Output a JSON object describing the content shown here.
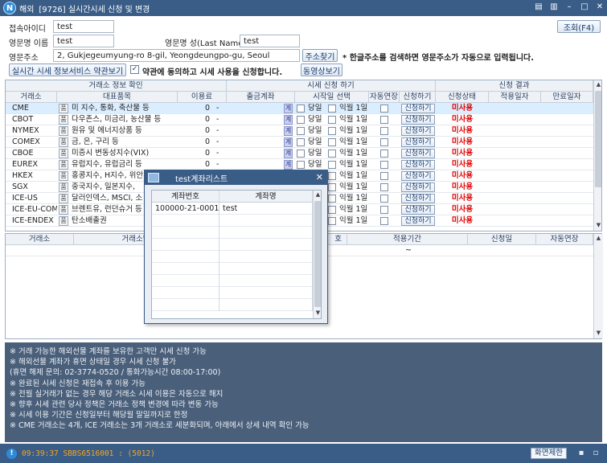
{
  "window": {
    "brand": "해외",
    "logo_char": "N",
    "title": "[9726] 실시간시세 신청 및 변경",
    "controls": [
      "▤",
      "▥",
      "–",
      "□",
      "✕"
    ]
  },
  "form": {
    "login_id_label": "접속아이디",
    "login_id_value": "test",
    "eng_first_label": "영문명 이름",
    "eng_first_value": "test",
    "eng_last_label": "영문명 성(Last Name)",
    "eng_last_value": "test",
    "eng_addr_label": "영문주소",
    "eng_addr_value": "2, Gukjegeumyung-ro 8-gil, Yeongdeungpo-gu, Seoul",
    "addr_search_btn": "주소찾기",
    "addr_note": "* 한글주소를 검색하면 영문주소가 자동으로 입력됩니다.",
    "query_btn": "조회(F4)",
    "terms_btn": "실시간 시세 정보서비스 약관보기",
    "agree_check": "✓",
    "agree_label": "약관에 동의하고 시세 사용을 신청합니다.",
    "video_btn": "동영상보기"
  },
  "grid": {
    "groups": [
      "거래소 정보 확인",
      "시세 신청 하기",
      "신청 결과"
    ],
    "columns": [
      "거래소",
      "대표품목",
      "이용료",
      "출금계좌",
      "시작일 선택",
      "자동연장",
      "신청하기",
      "신청상태",
      "적용일자",
      "만료일자"
    ],
    "pm_label": "품",
    "gye_label": "계",
    "opt_today": "당일",
    "opt_next_month": "익월 1일",
    "apply_label": "신청하기",
    "rows": [
      {
        "exchange": "CME",
        "item": "미 지수, 통화, 축산물 등",
        "fee": "0",
        "dash": "-",
        "status": "미사용"
      },
      {
        "exchange": "CBOT",
        "item": "다우존스, 미금리, 농산물 등",
        "fee": "0",
        "dash": "-",
        "status": "미사용"
      },
      {
        "exchange": "NYMEX",
        "item": "원유 및 에너지상품 등",
        "fee": "0",
        "dash": "-",
        "status": "미사용"
      },
      {
        "exchange": "COMEX",
        "item": "금, 은, 구리 등",
        "fee": "0",
        "dash": "-",
        "status": "미사용"
      },
      {
        "exchange": "CBOE",
        "item": "미증시 변동성지수(VIX)",
        "fee": "0",
        "dash": "-",
        "status": "미사용"
      },
      {
        "exchange": "EUREX",
        "item": "유럽지수, 유럽금리 등",
        "fee": "0",
        "dash": "-",
        "status": "미사용"
      },
      {
        "exchange": "HKEX",
        "item": "홍콩지수, H지수, 위안",
        "fee": "0",
        "dash": "-",
        "status": "미사용"
      },
      {
        "exchange": "SGX",
        "item": "중국지수, 일본지수,",
        "fee": "0",
        "dash": "-",
        "status": "미사용"
      },
      {
        "exchange": "ICE-US",
        "item": "달러인덱스, MSCI, 소",
        "fee": "0",
        "dash": "-",
        "status": "미사용"
      },
      {
        "exchange": "ICE-EU-COM",
        "item": "브렌트유, 런던슈거 등",
        "fee": "0",
        "dash": "-",
        "status": "미사용"
      },
      {
        "exchange": "ICE-ENDEX",
        "item": "탄소배출권",
        "fee": "0",
        "dash": "-",
        "status": "미사용"
      }
    ]
  },
  "grid2": {
    "columns": [
      "거래소",
      "거래소명",
      "호",
      "적용기간",
      "신청일",
      "자동연장"
    ],
    "tilde": "~"
  },
  "info_lines": [
    "※ 거래 가능한 해외선물 계좌를 보유한 고객만 시세 신청 가능",
    "※ 해외선물 계좌가 휴면 상태일 경우 시세 신청 불가",
    "   (휴면 해제 문의: 02-3774-0520 / 통화가능시간 08:00-17:00)",
    "※ 완료된 시세 신청은 재접속 후 이용 가능",
    "※ 전월 실거래가 없는 경우 해당 거래소 시세 이용은 자동으로 해지",
    "※ 향후 시세 관련 당사 정책은 거래소 정책 변경에 따라 변동 가능",
    "※ 시세 이용 기간은 신청일부터 해당월 말일까지로 한정",
    "※ CME 거래소는 4개, ICE 거래소는 3개 거래소로 세분화되며, 아래에서 상세 내역 확인 가능"
  ],
  "statusbar": {
    "icon": "!",
    "message": "09:39:37 SBBS6516001 : (5012)",
    "screen_limit": "화면제한",
    "save_icon": "▪",
    "print_icon": "▫"
  },
  "popup": {
    "title": "test계좌리스트",
    "close": "✕",
    "col_account_no": "계좌번호",
    "col_account_name": "계좌명",
    "rows": [
      {
        "account_no": "100000-21-0001",
        "account_name": "test"
      }
    ]
  }
}
